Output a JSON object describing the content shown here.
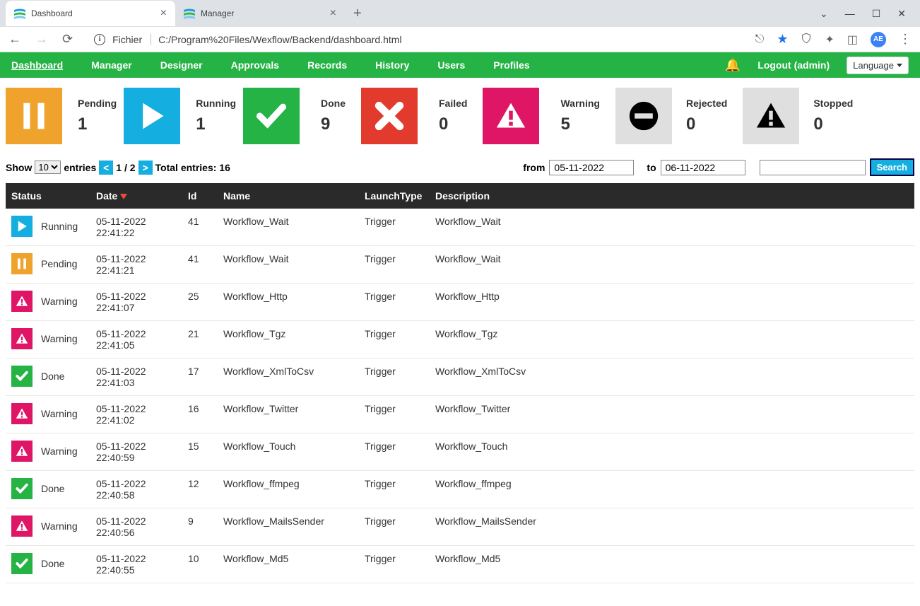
{
  "browser": {
    "tabs": [
      {
        "title": "Dashboard",
        "active": true
      },
      {
        "title": "Manager",
        "active": false
      }
    ],
    "url_label": "Fichier",
    "url_path": "C:/Program%20Files/Wexflow/Backend/dashboard.html",
    "avatar_initials": "AE"
  },
  "nav": {
    "items": [
      "Dashboard",
      "Manager",
      "Designer",
      "Approvals",
      "Records",
      "History",
      "Users",
      "Profiles"
    ],
    "active_index": 0,
    "logout": "Logout (admin)",
    "language": "Language"
  },
  "stats": [
    {
      "label": "Pending",
      "value": "1",
      "color": "bg-orange",
      "icon": "pause"
    },
    {
      "label": "Running",
      "value": "1",
      "color": "bg-blue",
      "icon": "play"
    },
    {
      "label": "Done",
      "value": "9",
      "color": "bg-red",
      "icon": "x",
      "prefix_gap": true
    },
    {
      "label": "Failed",
      "value": "0",
      "color": "bg-magenta",
      "icon": "warn"
    },
    {
      "label": "Warning",
      "value": "5",
      "color": "bg-gray",
      "icon": "minus"
    },
    {
      "label": "Rejected",
      "value": "0",
      "color": "bg-gray",
      "icon": "warn-black"
    },
    {
      "label": "Stopped",
      "value": "0",
      "color": "",
      "icon": ""
    }
  ],
  "stats_done_special": {
    "label": "Done",
    "value": "9",
    "check_color": "bg-green"
  },
  "controls": {
    "show": "Show",
    "entries_per_page": "10",
    "entries_label": "entries",
    "page_current": "1",
    "page_total": "2",
    "total_label": "Total entries: 16",
    "from_label": "from",
    "to_label": "to",
    "from_date": "05-11-2022",
    "to_date": "06-11-2022",
    "search_btn": "Search"
  },
  "table": {
    "headers": [
      "Status",
      "Date",
      "Id",
      "Name",
      "LaunchType",
      "Description"
    ],
    "rows": [
      {
        "status": "Running",
        "icon": "play",
        "color": "bg-blue",
        "date": "05-11-2022 22:41:22",
        "id": "41",
        "name": "Workflow_Wait",
        "launch": "Trigger",
        "desc": "Workflow_Wait"
      },
      {
        "status": "Pending",
        "icon": "pause",
        "color": "bg-orange",
        "date": "05-11-2022 22:41:21",
        "id": "41",
        "name": "Workflow_Wait",
        "launch": "Trigger",
        "desc": "Workflow_Wait"
      },
      {
        "status": "Warning",
        "icon": "warn",
        "color": "bg-magenta",
        "date": "05-11-2022 22:41:07",
        "id": "25",
        "name": "Workflow_Http",
        "launch": "Trigger",
        "desc": "Workflow_Http"
      },
      {
        "status": "Warning",
        "icon": "warn",
        "color": "bg-magenta",
        "date": "05-11-2022 22:41:05",
        "id": "21",
        "name": "Workflow_Tgz",
        "launch": "Trigger",
        "desc": "Workflow_Tgz"
      },
      {
        "status": "Done",
        "icon": "check",
        "color": "bg-green",
        "date": "05-11-2022 22:41:03",
        "id": "17",
        "name": "Workflow_XmlToCsv",
        "launch": "Trigger",
        "desc": "Workflow_XmlToCsv"
      },
      {
        "status": "Warning",
        "icon": "warn",
        "color": "bg-magenta",
        "date": "05-11-2022 22:41:02",
        "id": "16",
        "name": "Workflow_Twitter",
        "launch": "Trigger",
        "desc": "Workflow_Twitter"
      },
      {
        "status": "Warning",
        "icon": "warn",
        "color": "bg-magenta",
        "date": "05-11-2022 22:40:59",
        "id": "15",
        "name": "Workflow_Touch",
        "launch": "Trigger",
        "desc": "Workflow_Touch"
      },
      {
        "status": "Done",
        "icon": "check",
        "color": "bg-green",
        "date": "05-11-2022 22:40:58",
        "id": "12",
        "name": "Workflow_ffmpeg",
        "launch": "Trigger",
        "desc": "Workflow_ffmpeg"
      },
      {
        "status": "Warning",
        "icon": "warn",
        "color": "bg-magenta",
        "date": "05-11-2022 22:40:56",
        "id": "9",
        "name": "Workflow_MailsSender",
        "launch": "Trigger",
        "desc": "Workflow_MailsSender"
      },
      {
        "status": "Done",
        "icon": "check",
        "color": "bg-green",
        "date": "05-11-2022 22:40:55",
        "id": "10",
        "name": "Workflow_Md5",
        "launch": "Trigger",
        "desc": "Workflow_Md5"
      }
    ]
  }
}
